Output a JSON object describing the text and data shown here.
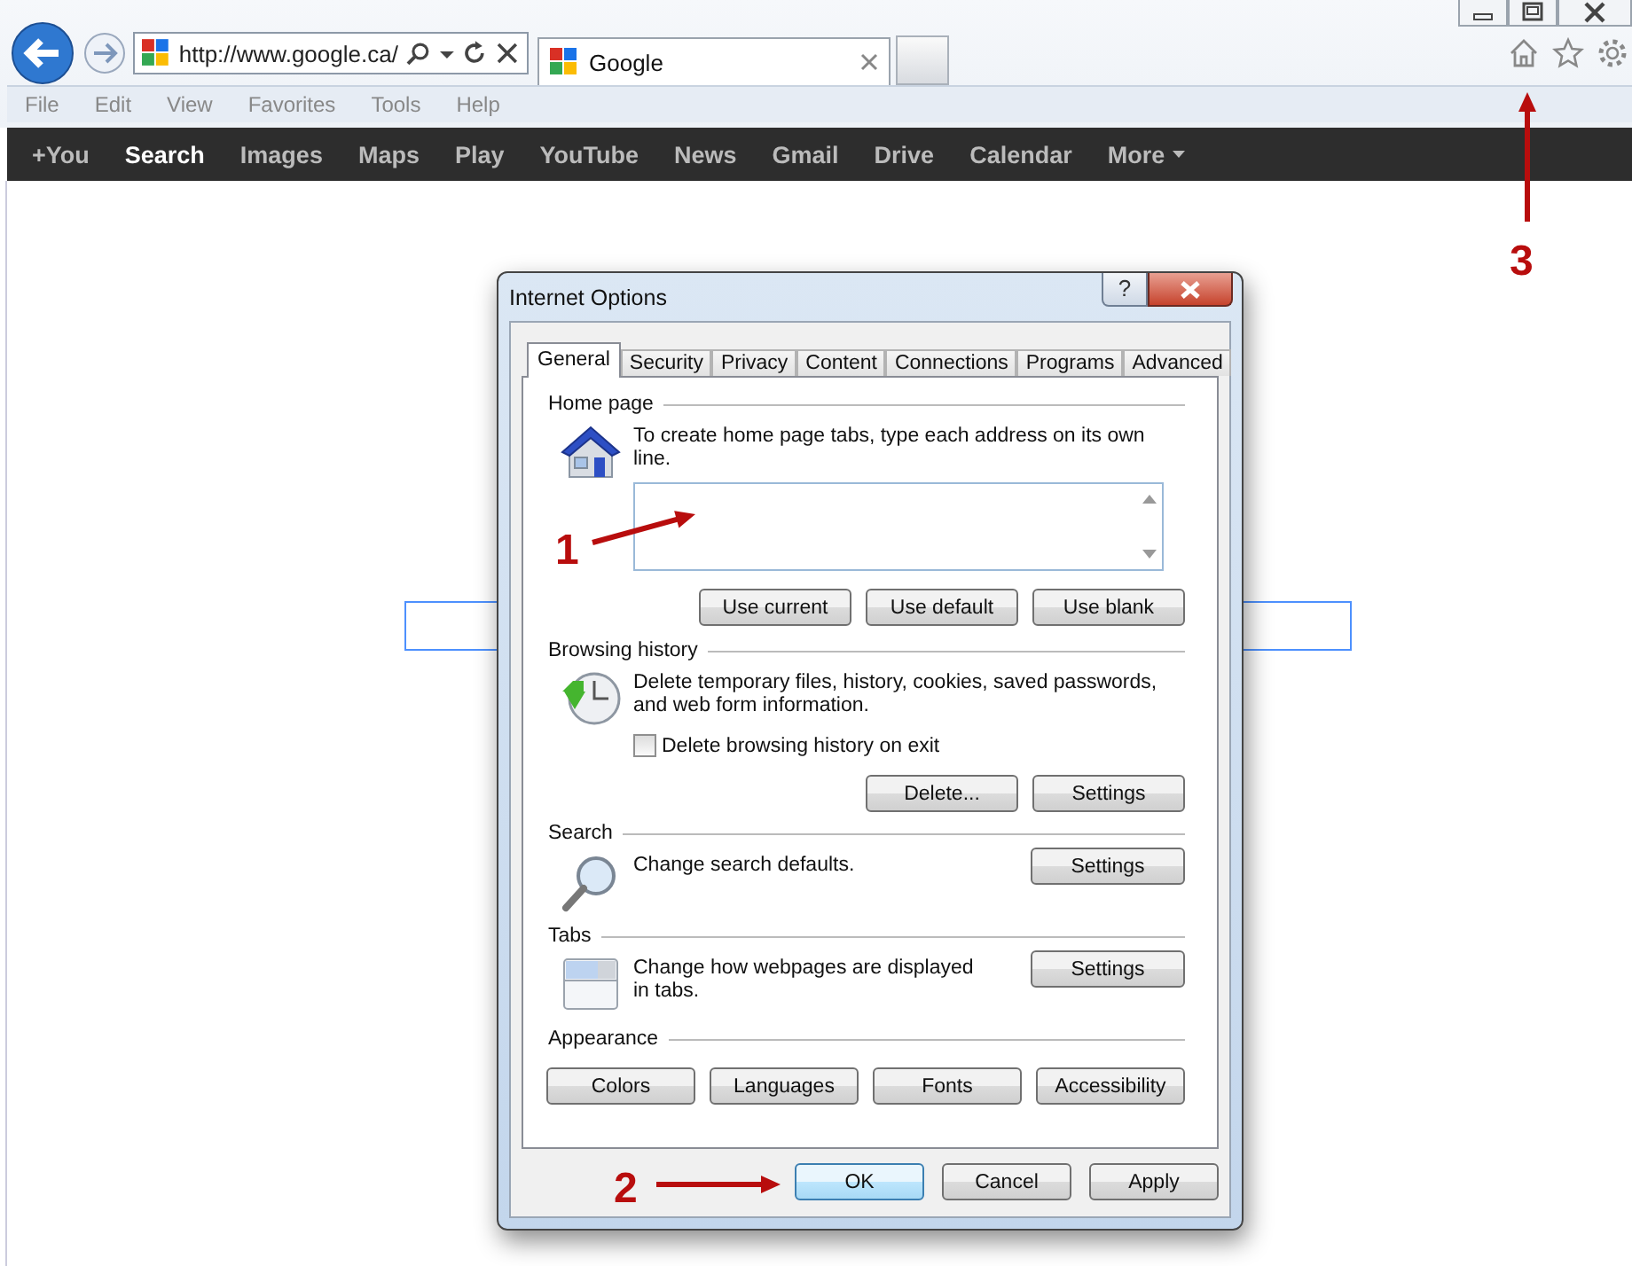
{
  "browser": {
    "address": "http://www.google.ca/",
    "tab_title": "Google",
    "menu": [
      "File",
      "Edit",
      "View",
      "Favorites",
      "Tools",
      "Help"
    ],
    "nav": [
      {
        "label": "+You",
        "selected": false
      },
      {
        "label": "Search",
        "selected": true
      },
      {
        "label": "Images",
        "selected": false
      },
      {
        "label": "Maps",
        "selected": false
      },
      {
        "label": "Play",
        "selected": false
      },
      {
        "label": "YouTube",
        "selected": false
      },
      {
        "label": "News",
        "selected": false
      },
      {
        "label": "Gmail",
        "selected": false
      },
      {
        "label": "Drive",
        "selected": false
      },
      {
        "label": "Calendar",
        "selected": false
      },
      {
        "label": "More",
        "selected": false,
        "kind": "dropdown"
      }
    ]
  },
  "dialog": {
    "title": "Internet Options",
    "help": "?",
    "tabs": [
      {
        "label": "General",
        "selected": true
      },
      {
        "label": "Security",
        "selected": false
      },
      {
        "label": "Privacy",
        "selected": false
      },
      {
        "label": "Content",
        "selected": false
      },
      {
        "label": "Connections",
        "selected": false
      },
      {
        "label": "Programs",
        "selected": false
      },
      {
        "label": "Advanced",
        "selected": false
      }
    ],
    "sections": [
      {
        "kind": "home_page",
        "heading": "Home page",
        "description": "To create home page tabs, type each address on its own line.",
        "buttons": [
          "Use current",
          "Use default",
          "Use blank"
        ]
      },
      {
        "kind": "history",
        "heading": "Browsing history",
        "description": "Delete temporary files, history, cookies, saved passwords, and web form information.",
        "checkbox": {
          "label": "Delete browsing history on exit",
          "checked": false
        },
        "buttons": [
          "Delete...",
          "Settings"
        ]
      },
      {
        "kind": "search",
        "heading": "Search",
        "description": "Change search defaults.",
        "buttons": [
          "Settings"
        ]
      },
      {
        "kind": "tabs",
        "heading": "Tabs",
        "description": "Change how webpages are displayed in tabs.",
        "buttons": [
          "Settings"
        ]
      },
      {
        "kind": "appearance",
        "heading": "Appearance",
        "buttons": [
          "Colors",
          "Languages",
          "Fonts",
          "Accessibility"
        ]
      }
    ],
    "footer": [
      {
        "label": "OK",
        "default": true
      },
      {
        "label": "Cancel",
        "default": false
      },
      {
        "label": "Apply",
        "default": false
      }
    ]
  },
  "callouts": [
    {
      "label": "1"
    },
    {
      "label": "2"
    },
    {
      "label": "3"
    }
  ]
}
